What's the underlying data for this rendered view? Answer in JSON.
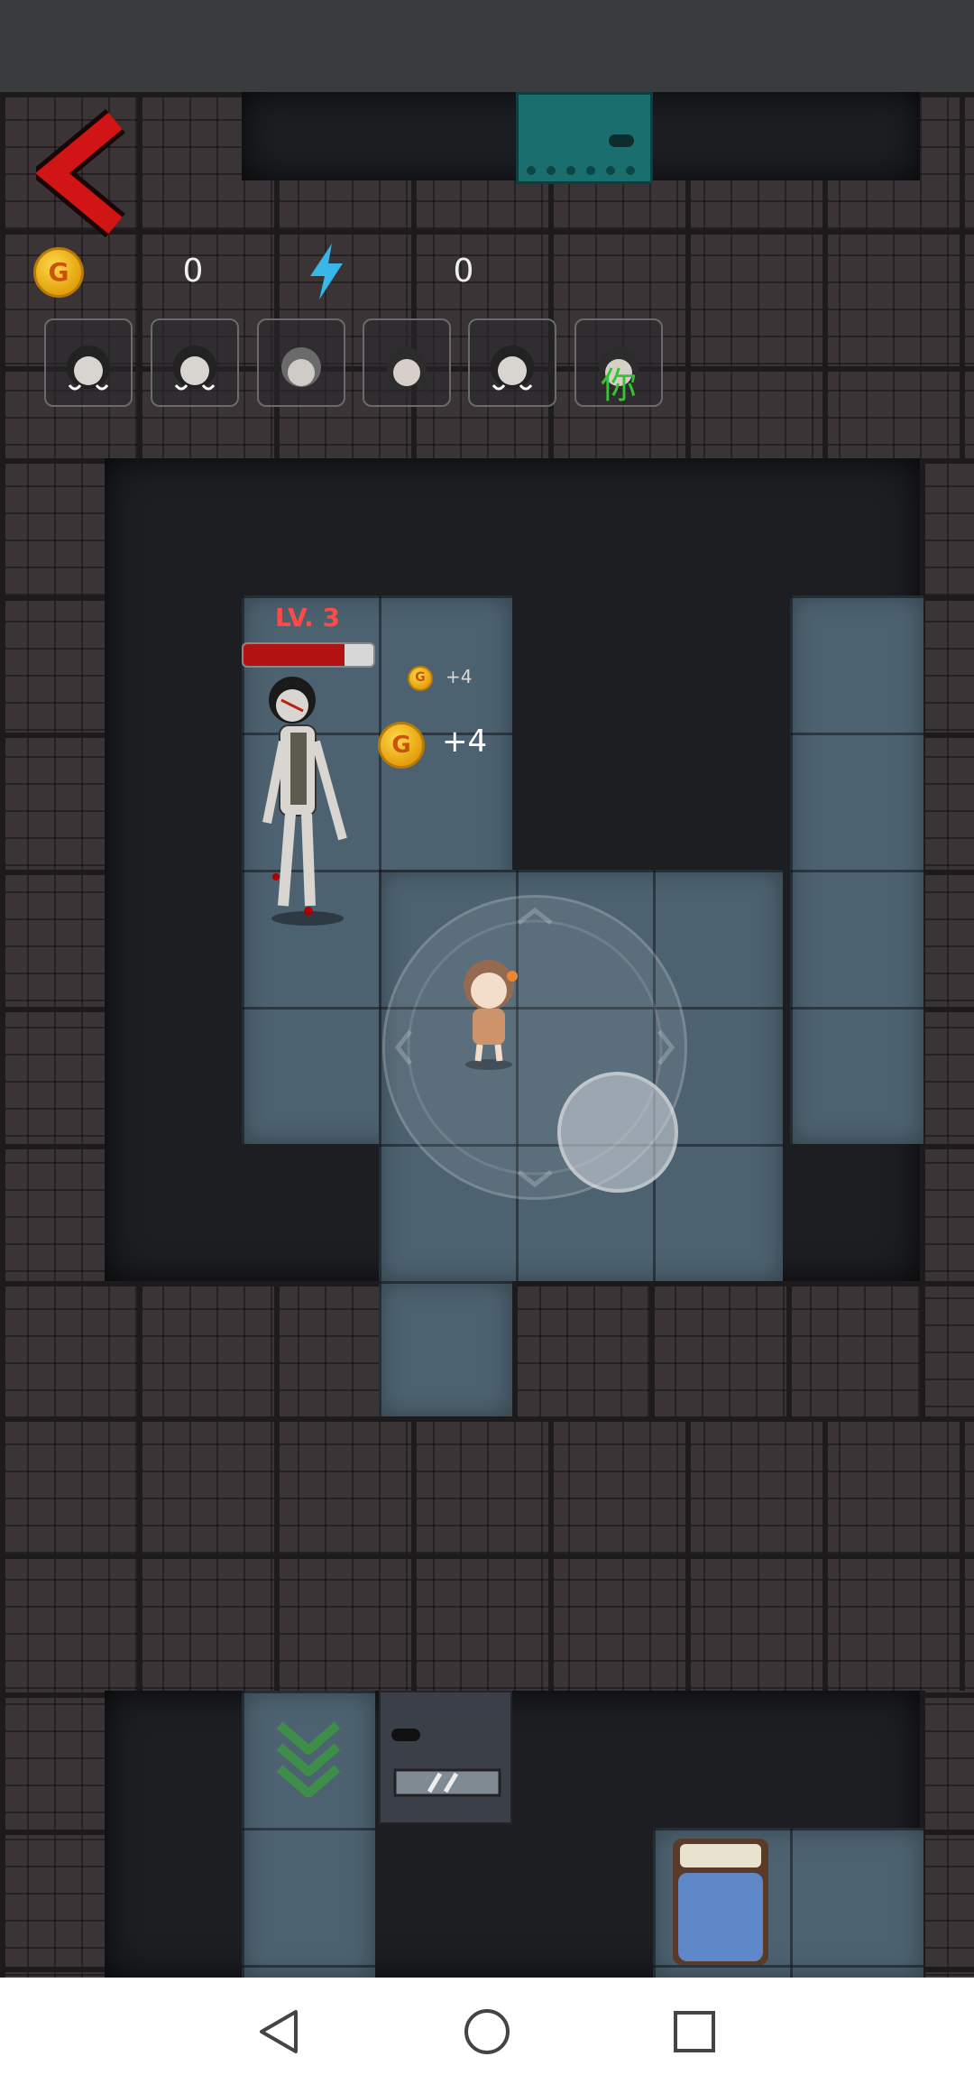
{
  "hud": {
    "coins": "0",
    "energy": "0",
    "coin_symbol": "G",
    "you_label": "你"
  },
  "enemy": {
    "level": "LV. 3",
    "hp_fraction": 0.78
  },
  "pickups": {
    "small_gain": "+4",
    "big_gain": "+4"
  },
  "colors": {
    "back_arrow": "#d11414",
    "energy_bolt": "#39b7e8",
    "you_label": "#38c238",
    "hp_fill": "#b31212",
    "level_text": "#ff4a4a"
  },
  "icons": {
    "back": "back-arrow-icon",
    "coin": "coin-icon",
    "energy": "lightning-icon",
    "nav_back": "triangle-back-icon",
    "nav_home": "circle-home-icon",
    "nav_recents": "square-recents-icon"
  }
}
